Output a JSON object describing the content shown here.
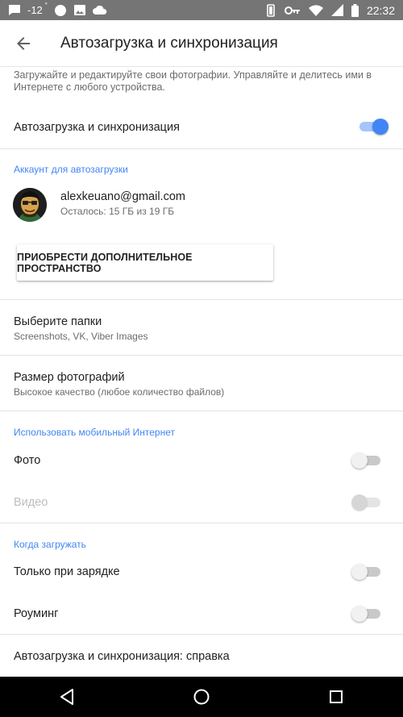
{
  "status_bar": {
    "temperature": "-12",
    "temperature_unit": "°",
    "time": "22:32",
    "icons_left": [
      "message-icon",
      "cloud-sun-icon",
      "image-icon",
      "cloud-icon"
    ],
    "icons_right": [
      "vibrate-icon",
      "key-icon",
      "wifi-icon",
      "signal-icon",
      "battery-icon"
    ]
  },
  "app_bar": {
    "title": "Автозагрузка и синхронизация",
    "back_icon": "arrow-back-icon"
  },
  "description": "Загружайте и редактируйте свои фотографии. Управляйте и делитесь ими в Интернете с любого устройства.",
  "sync_toggle": {
    "label": "Автозагрузка и синхронизация",
    "on": true
  },
  "account_section": {
    "header": "Аккаунт для автозагрузки",
    "email": "alexkeuano@gmail.com",
    "storage": "Осталось: 15 ГБ из 19 ГБ",
    "buy_button": "ПРИОБРЕСТИ ДОПОЛНИТЕЛЬНОЕ ПРОСТРАНСТВО"
  },
  "folders": {
    "title": "Выберите папки",
    "value": "Screenshots, VK, Viber Images"
  },
  "photo_size": {
    "title": "Размер фотографий",
    "value": "Высокое качество (любое количество файлов)"
  },
  "mobile_section": {
    "header": "Использовать мобильный Интернет",
    "photo_label": "Фото",
    "photo_on": false,
    "video_label": "Видео",
    "video_on": false,
    "video_enabled": false
  },
  "when_section": {
    "header": "Когда загружать",
    "charging_label": "Только при зарядке",
    "charging_on": false,
    "roaming_label": "Роуминг",
    "roaming_on": false
  },
  "help_link": "Автозагрузка и синхронизация: справка",
  "colors": {
    "accent": "#4285f4",
    "status_bar": "#757575",
    "nav_bar": "#000000"
  }
}
